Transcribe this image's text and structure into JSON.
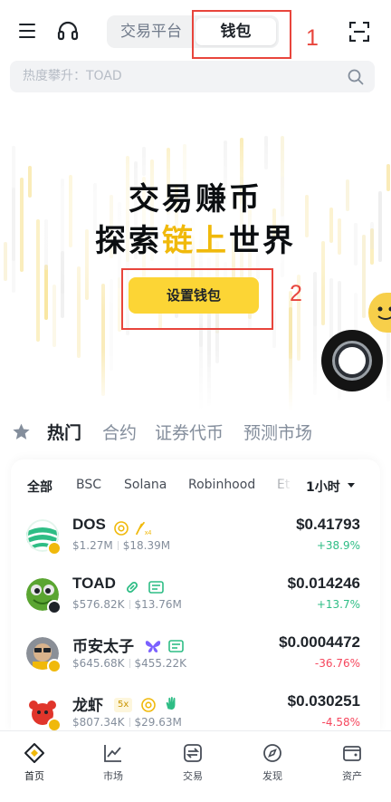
{
  "header": {
    "segment_tabs": [
      {
        "label": "交易平台",
        "active": false
      },
      {
        "label": "钱包",
        "active": true
      }
    ],
    "icons": [
      "menu-icon",
      "headset-icon",
      "scan-icon"
    ]
  },
  "search": {
    "placeholder": "热度攀升：TOAD",
    "icon": "search-icon"
  },
  "annotations": [
    {
      "number": "1",
      "target": "钱包 tab"
    },
    {
      "number": "2",
      "target": "设置钱包 button"
    }
  ],
  "hero": {
    "line1": "交易赚币",
    "line2_pre": "探索",
    "line2_highlight": "链上",
    "line2_post": "世界",
    "cta_label": "设置钱包"
  },
  "categories": [
    {
      "label": "热门",
      "active": true
    },
    {
      "label": "合约",
      "active": false
    },
    {
      "label": "证券代币",
      "active": false
    },
    {
      "label": "预测市场",
      "active": false
    }
  ],
  "chains": [
    {
      "label": "全部",
      "active": true
    },
    {
      "label": "BSC",
      "active": false
    },
    {
      "label": "Solana",
      "active": false
    },
    {
      "label": "Robinhood",
      "active": false
    },
    {
      "label": "Et",
      "active": false
    }
  ],
  "timeframe": "1小时",
  "tokens": [
    {
      "name": "DOS",
      "volume": "$1.27M",
      "mcap": "$18.39M",
      "price": "$0.41793",
      "change": "+38.9%",
      "direction": "up",
      "tags": [
        "at-icon",
        "boost-x4-icon"
      ]
    },
    {
      "name": "TOAD",
      "volume": "$576.82K",
      "mcap": "$13.76M",
      "price": "$0.014246",
      "change": "+13.7%",
      "direction": "up",
      "tags": [
        "pill-icon",
        "contract-icon"
      ]
    },
    {
      "name": "币安太子",
      "volume": "$645.68K",
      "mcap": "$455.22K",
      "price": "$0.0004472",
      "change": "-36.76%",
      "direction": "down",
      "tags": [
        "butterfly-icon",
        "contract-icon"
      ]
    },
    {
      "name": "龙虾",
      "volume": "$807.34K",
      "mcap": "$29.63M",
      "price": "$0.030251",
      "change": "-4.58%",
      "direction": "down",
      "tags": [
        "5x",
        "at-icon",
        "hand-icon"
      ]
    }
  ],
  "nav": [
    {
      "label": "首页",
      "icon": "home-icon",
      "active": true
    },
    {
      "label": "市场",
      "icon": "chart-icon",
      "active": false
    },
    {
      "label": "交易",
      "icon": "swap-icon",
      "active": false
    },
    {
      "label": "发现",
      "icon": "compass-icon",
      "active": false
    },
    {
      "label": "资产",
      "icon": "wallet-icon",
      "active": false
    }
  ],
  "colors": {
    "brand": "#fcd535",
    "accent": "#f0b90b",
    "up": "#2ebd85",
    "down": "#f6465d",
    "annotation": "#e8453c"
  }
}
